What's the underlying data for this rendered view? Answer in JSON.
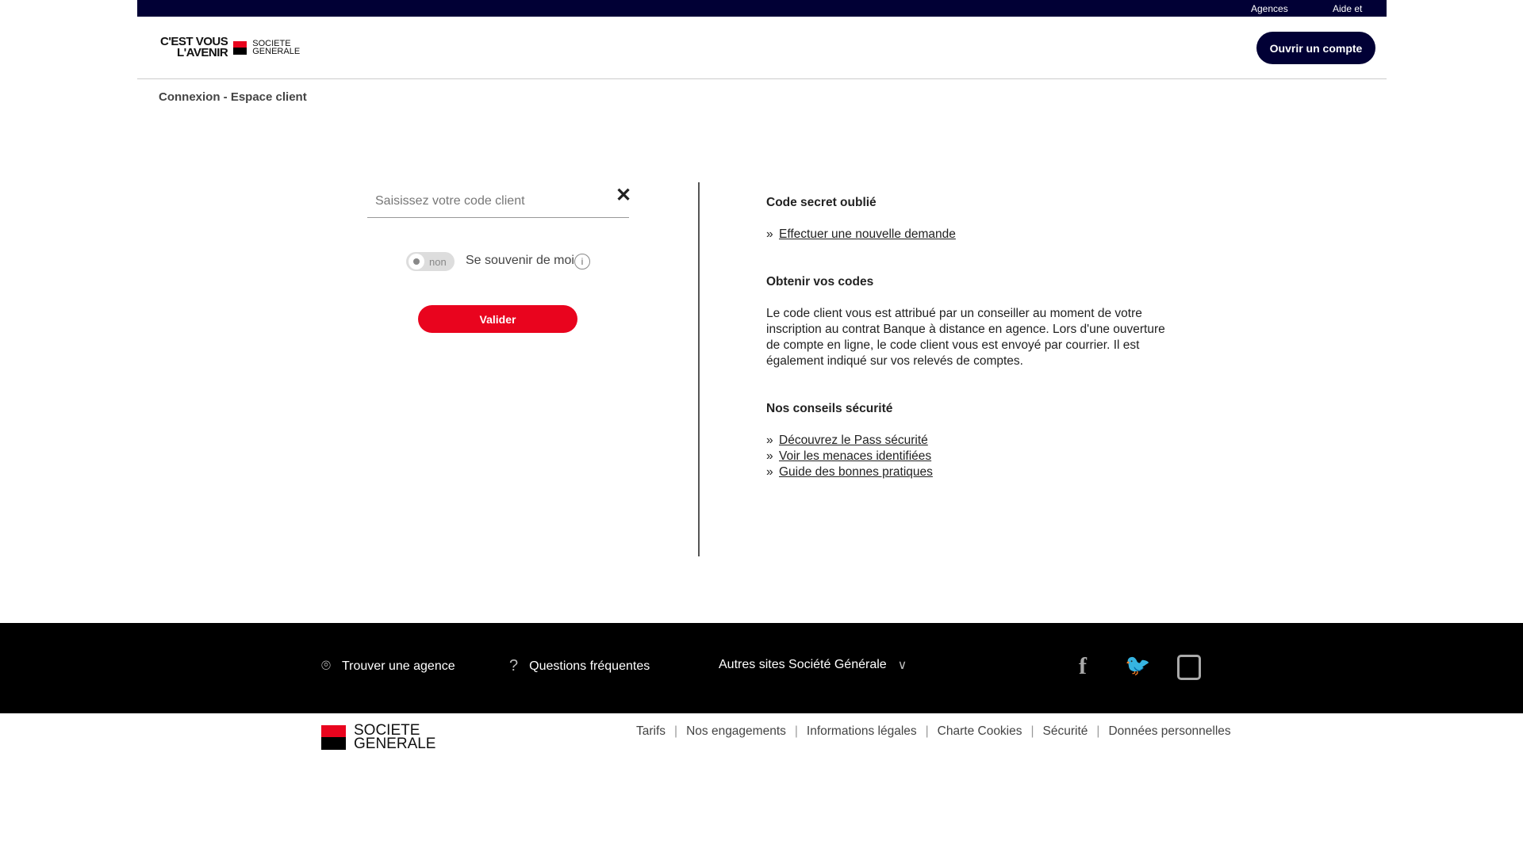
{
  "topbar": {
    "links": [
      "Agences",
      "Aide et contacts"
    ]
  },
  "header": {
    "slogan_line1": "C'EST VOUS",
    "slogan_line2": "L'AVENIR",
    "brand_line1": "SOCIETE",
    "brand_line2": "GENERALE",
    "open_account": "Ouvrir un compte"
  },
  "breadcrumb": "Connexion - Espace client",
  "login": {
    "placeholder": "Saisissez votre code client",
    "clear": "✕",
    "toggle_state": "non",
    "remember_label": "Se souvenir de moi",
    "info": "i",
    "submit": "Valider"
  },
  "side": {
    "forgot_title": "Code secret oublié",
    "forgot_link": "Effectuer une nouvelle demande",
    "codes_title": "Obtenir vos codes",
    "codes_text": "Le code client vous est attribué par un conseiller au moment de votre inscription au contrat Banque à distance en agence. Lors d'une ouverture de compte en ligne, le code client vous est envoyé par courrier. Il est également indiqué sur vos relevés de comptes.",
    "security_title": "Nos conseils sécurité",
    "security_links": [
      "Découvrez le Pass sécurité",
      "Voir les menaces identifiées",
      "Guide des bonnes pratiques"
    ]
  },
  "footer": {
    "find_agency": "Trouver une agence",
    "faq": "Questions fréquentes",
    "other_sites": "Autres sites Société Générale",
    "social": [
      "f",
      "t",
      "ig"
    ]
  },
  "bottom": {
    "brand_line1": "SOCIETE",
    "brand_line2": "GENERALE",
    "links": [
      "Tarifs",
      "Nos engagements",
      "Informations légales",
      "Charte Cookies",
      "Sécurité",
      "Données personnelles"
    ]
  },
  "colors": {
    "navy": "#010035",
    "red": "#e9041e"
  }
}
